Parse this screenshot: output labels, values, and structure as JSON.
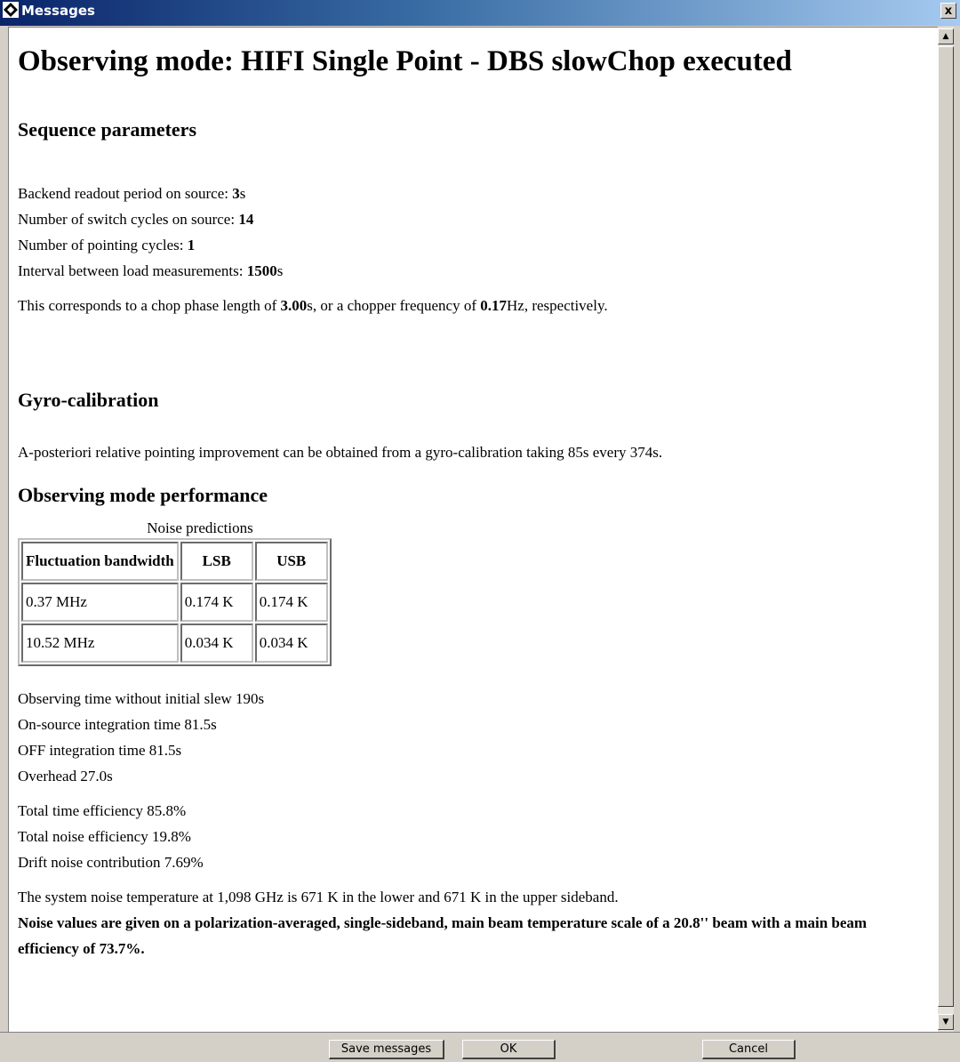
{
  "window": {
    "title": "Messages",
    "close_label": "x"
  },
  "report": {
    "heading": "Observing mode: HIFI Single Point - DBS slowChop executed",
    "sequence": {
      "heading": "Sequence parameters",
      "readout_label": "Backend readout period on source: ",
      "readout_value": "3",
      "readout_unit": "s",
      "switch_label": "Number of switch cycles on source: ",
      "switch_value": "14",
      "pointing_label": "Number of pointing cycles: ",
      "pointing_value": "1",
      "interval_label": "Interval between load measurements: ",
      "interval_value": "1500",
      "interval_unit": "s",
      "chop_text_1": "This corresponds to a chop phase length of ",
      "chop_phase_value": "3.00",
      "chop_text_2": "s, or a chopper frequency of ",
      "chop_freq_value": "0.17",
      "chop_text_3": "Hz, respectively."
    },
    "gyro": {
      "heading": "Gyro-calibration",
      "text": "A-posteriori relative pointing improvement can be obtained from a gyro-calibration taking 85s every 374s."
    },
    "performance": {
      "heading": "Observing mode performance",
      "caption": "Noise predictions",
      "columns": [
        "Fluctuation bandwidth",
        "LSB",
        "USB"
      ],
      "rows": [
        [
          "0.37 MHz",
          "0.174 K",
          "0.174 K"
        ],
        [
          "10.52 MHz",
          "0.034 K",
          "0.034 K"
        ]
      ],
      "time_lines": [
        "Observing time without initial slew 190s",
        "On-source integration time 81.5s",
        "OFF integration time 81.5s",
        "Overhead 27.0s"
      ],
      "efficiency_lines": [
        "Total time efficiency 85.8%",
        "Total noise efficiency 19.8%",
        "Drift noise contribution 7.69%"
      ],
      "system_noise": "The system noise temperature at 1,098 GHz is 671 K in the lower and 671 K in the upper sideband.",
      "noise_note": "Noise values are given on a polarization-averaged, single-sideband, main beam temperature scale of a 20.8'' beam with a main beam efficiency of 73.7%."
    }
  },
  "buttons": {
    "save": "Save messages",
    "ok": "OK",
    "cancel": "Cancel"
  },
  "icons": {
    "window": "diamond-app-icon",
    "scroll_up": "arrow-up-icon",
    "scroll_down": "arrow-down-icon"
  }
}
